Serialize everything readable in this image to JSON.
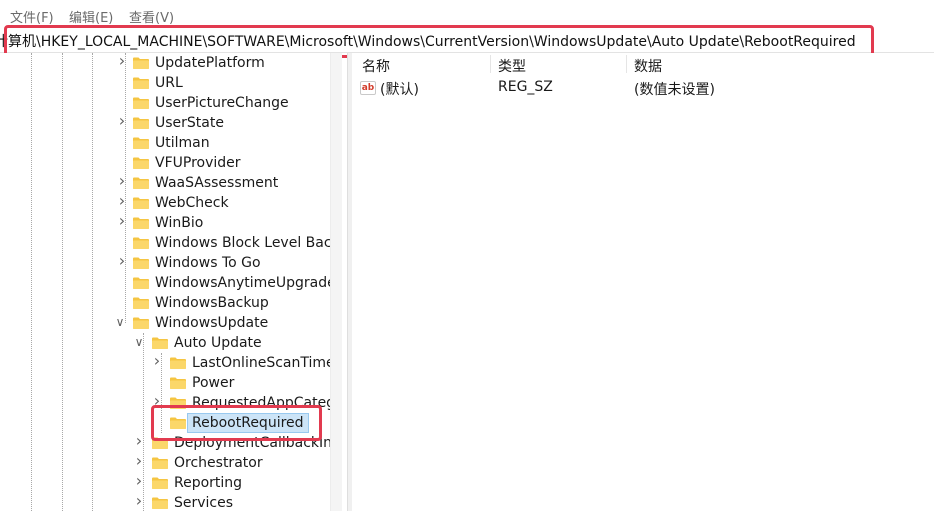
{
  "menu": [
    {
      "label": "文件(F)"
    },
    {
      "label": "编辑(E)"
    },
    {
      "label": "查看(V)"
    }
  ],
  "address": {
    "path": "计算机\\HKEY_LOCAL_MACHINE\\SOFTWARE\\Microsoft\\Windows\\CurrentVersion\\WindowsUpdate\\Auto Update\\RebootRequired"
  },
  "tree": {
    "items": [
      {
        "label": "UpdatePlatform",
        "expander": "collapsed"
      },
      {
        "label": "URL",
        "expander": "none"
      },
      {
        "label": "UserPictureChange",
        "expander": "none"
      },
      {
        "label": "UserState",
        "expander": "collapsed"
      },
      {
        "label": "Utilman",
        "expander": "none"
      },
      {
        "label": "VFUProvider",
        "expander": "none"
      },
      {
        "label": "WaaSAssessment",
        "expander": "collapsed"
      },
      {
        "label": "WebCheck",
        "expander": "collapsed"
      },
      {
        "label": "WinBio",
        "expander": "collapsed"
      },
      {
        "label": "Windows Block Level Backu",
        "expander": "none"
      },
      {
        "label": "Windows To Go",
        "expander": "collapsed"
      },
      {
        "label": "WindowsAnytimeUpgrade",
        "expander": "none"
      },
      {
        "label": "WindowsBackup",
        "expander": "none"
      },
      {
        "label": "WindowsUpdate",
        "expander": "expanded"
      },
      {
        "label": "Auto Update",
        "expander": "expanded"
      },
      {
        "label": "LastOnlineScanTimeF",
        "expander": "collapsed"
      },
      {
        "label": "Power",
        "expander": "none"
      },
      {
        "label": "RequestedAppCateg",
        "expander": "collapsed"
      },
      {
        "label": "RebootRequired",
        "expander": "none",
        "selected": true
      },
      {
        "label": "DeploymentCallbackInfo",
        "expander": "collapsed"
      },
      {
        "label": "Orchestrator",
        "expander": "collapsed"
      },
      {
        "label": "Reporting",
        "expander": "collapsed"
      },
      {
        "label": "Services",
        "expander": "collapsed"
      }
    ]
  },
  "values": {
    "columns": {
      "name": "名称",
      "type": "类型",
      "data": "数据"
    },
    "rows": [
      {
        "name": "(默认)",
        "type": "REG_SZ",
        "data": "(数值未设置)",
        "icon": "string-value-icon"
      }
    ]
  },
  "colors": {
    "highlight": "#e23a4f",
    "selection": "#cce4f7",
    "folder": "#f5c542"
  }
}
